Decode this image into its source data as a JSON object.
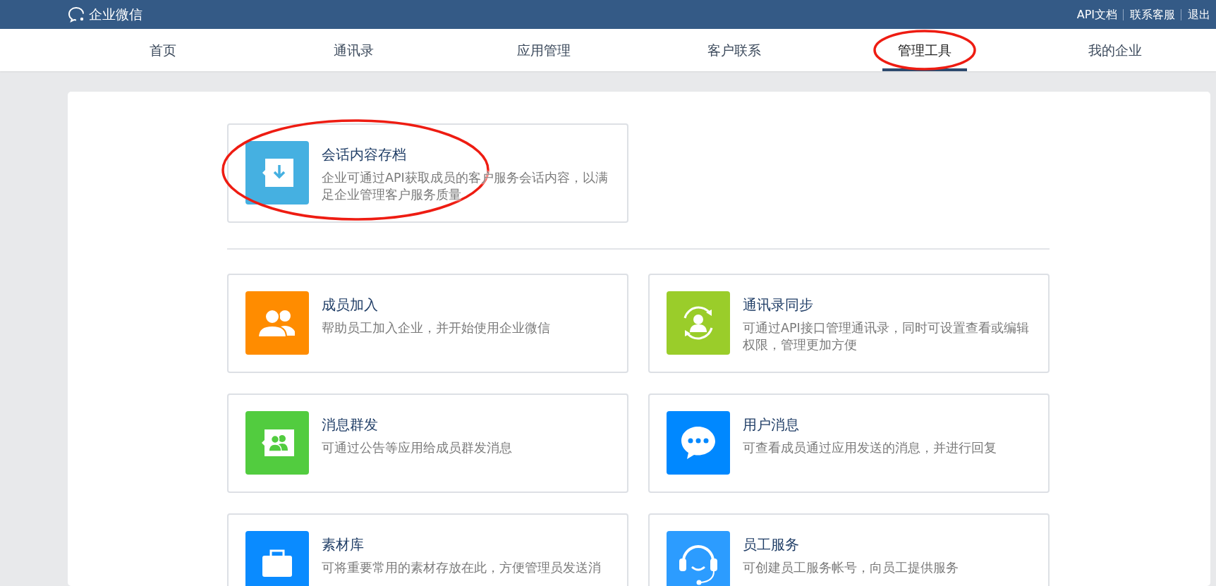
{
  "header": {
    "logo_text": "企业微信",
    "links": [
      "API文档",
      "联系客服",
      "退出"
    ]
  },
  "tabs": [
    {
      "label": "首页",
      "selected": false,
      "circled": false
    },
    {
      "label": "通讯录",
      "selected": false,
      "circled": false
    },
    {
      "label": "应用管理",
      "selected": false,
      "circled": false
    },
    {
      "label": "客户联系",
      "selected": false,
      "circled": false
    },
    {
      "label": "管理工具",
      "selected": true,
      "circled": true
    },
    {
      "label": "我的企业",
      "selected": false,
      "circled": false
    }
  ],
  "featured_tools": [
    {
      "kind": "archive",
      "color": "#45b0e1",
      "title": "会话内容存档",
      "description": "企业可通过API获取成员的客户服务会话内容，以满足企业管理客户服务质量",
      "circled": true
    }
  ],
  "tools": [
    {
      "kind": "members",
      "color": "#ff8c00",
      "title": "成员加入",
      "description": "帮助员工加入企业，并开始使用企业微信",
      "circled": false
    },
    {
      "kind": "sync",
      "color": "#9acd2a",
      "title": "通讯录同步",
      "description": "可通过API接口管理通讯录，同时可设置查看或编辑权限，管理更加方便",
      "circled": false
    },
    {
      "kind": "broadcast",
      "color": "#52cc3f",
      "title": "消息群发",
      "description": "可通过公告等应用给成员群发消息",
      "circled": false
    },
    {
      "kind": "message",
      "color": "#0088ff",
      "title": "用户消息",
      "description": "可查看成员通过应用发送的消息，并进行回复",
      "circled": false
    },
    {
      "kind": "materials",
      "color": "#0a8bff",
      "title": "素材库",
      "description": "可将重要常用的素材存放在此，方便管理员发送消",
      "circled": false
    },
    {
      "kind": "service",
      "color": "#2c9cff",
      "title": "员工服务",
      "description": "可创建员工服务帐号，向员工提供服务",
      "circled": false
    }
  ]
}
